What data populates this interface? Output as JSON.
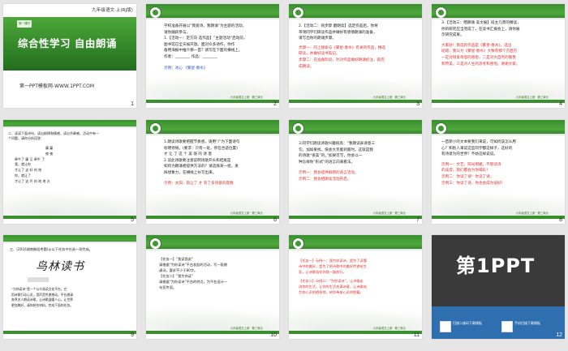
{
  "slides": [
    {
      "num": "1",
      "header": "九年级语文·上(RJ版)",
      "badge": "第一课时",
      "title": "综合性学习 自由朗诵",
      "site": "第一PPT模板网-WWW.1PPT.COM"
    },
    {
      "num": "2",
      "lines": [
        "学校准备开展以“我爱诗，我朗诵”为主题的活动，",
        "请你踊跃参与。",
        "1.【活动一：定方向  选作品】“主题活动”启动前，",
        "图书馆已全天候开放。面对众多诗作，你作",
        "备用海报中推介哪一首？请写在下面的横线上。",
        "作者：________  作品：________"
      ],
      "example": "示例：冰心 《繁星·春水》"
    },
    {
      "num": "3",
      "lines": [
        "2.【活动二：商步骤  磨朗读】选定作品后，你将",
        "带领同学们研读作品并做好有感情朗诵的准备，",
        "请写出你的朗诵步骤。"
      ],
      "red": [
        "步骤一：同上搜索与《繁星·春水》有关的作品，精选",
        "研读，并做好读书笔记。",
        "步骤二：在准备阶段，针对作品做好朗诵标注，再完",
        "成朗读。"
      ]
    },
    {
      "num": "4",
      "lines": [
        "3.【活动三：晒朗诵  美文展】班主几周的精读，",
        "你的研究应当完成了，在读书汇报会上，请你展",
        "示研究成果。"
      ],
      "red": [
        "大家好！我选的作品是《繁星·春水》，选出",
        "班级，我认为《繁星·春水》大致有那个方面方",
        "一是对母爱母恩的感恩，二是对大自然的敬畏",
        "和赞美，三是对人生的思考和感悟。谢谢大家。"
      ]
    },
    {
      "num": "5",
      "lines": [
        "二、读读下面诗句，读出韵律和情感，读出节奏感，活动中有一",
        "个问题，请你分析回答："
      ],
      "poem": [
        "藤 蔓",
        "夜 夜",
        "牵牛了 藤 又 牵牛 了",
        "我，就让你",
        "才让了 这 好 的 地",
        "你，就让了",
        "才让了 这 坏 的 地 地 方"
      ]
    },
    {
      "num": "6",
      "lines": [
        "1.朗读诗歌要把握节奏感，请用“/”为下面诗句",
        "标明停顿。(要求：只有一处，停在合适位置)",
        "才 让 了 这 个 美 丽 的 诗 意",
        "2.读此诗歌要注意说明诗歌开头和结尾是",
        "如何为朗诵者提供方法的？请选择某一组，发",
        "挥想象力，在横线上补写出来。"
      ],
      "example": "示例：太阳，就让了 才 有了多诗意的夜晚"
    },
    {
      "num": "7",
      "lines": [
        "3.同学们朗读诗歌兴趣很高：“我朗读表诗意三",
        "句，加如果找，快会大笑着到底时。这就是我",
        "的诗歌“很美”的。”如果可写，你会以一",
        "种怎样你“形式”的语言向来看法。"
      ],
      "blue": [
        "示例一：我会提供鲜明的语言活动。",
        "示例二：我会把朗读活动开启。"
      ]
    },
    {
      "num": "8",
      "lines": [
        "一首新小的文本要我们来说，可如何该怎么用",
        "心？和别人来说这些同学都这样子，这好的",
        "有诗意为的世界？不妨这样说说。"
      ],
      "red": [
        "示例一：文艺，阳光明媚，不管读诗",
        "的读得，我们都会为你喝彩！",
        "示例二：你读了诗！你读了诗。",
        "示例三：你读了诗，你也会成为很好！"
      ]
    },
    {
      "num": "9",
      "lines": [
        "三、(2016湖南衡阳考题)从以下任务中任选一项完成。"
      ],
      "calli": "鸟林读书",
      "body": [
        "“为你读诗”是一个公众阅读文化平台，它",
        "用诗歌打动心灵，用声音传递感动。平台邀请",
        "各界名人朗读诗歌，让诗歌温暖人心，让世界",
        "更加美好。请你结合材料，完成下面的任务。"
      ]
    },
    {
      "num": "10",
      "tags": [
        "【任务一】“我读我说”",
        "【任务二】“我为你读”"
      ],
      "lines": [
        "请根据“为你读诗”平台发起的活动，写一段朗",
        "诵词，要求不少于80字。",
        "请根据“为你读诗”平台的特点，为平台设计一",
        "句宣传语。"
      ]
    },
    {
      "num": "11",
      "red": [
        "【任务一】示例一：我为你读诗，是为了读懂",
        "诗中的美好，是为了把诗歌中的美好传递给大",
        "家，让诗歌陪伴你我一路前行。",
        "【任务二】示例二：“为你读诗”，让诗歌走",
        "进你的生活，让你的生活充满诗意，让诗歌成",
        "为你心灵的栖息地，给你带来心灵的慰藉。"
      ]
    },
    {
      "num": "12",
      "brand_left": "第",
      "brand_num": "1",
      "brand_right": "PPT",
      "qr1": "扫描二维码下载模板",
      "qr2": "手机扫描下载模板"
    }
  ],
  "footer_text": "九年级语文上册 · 第三单元"
}
